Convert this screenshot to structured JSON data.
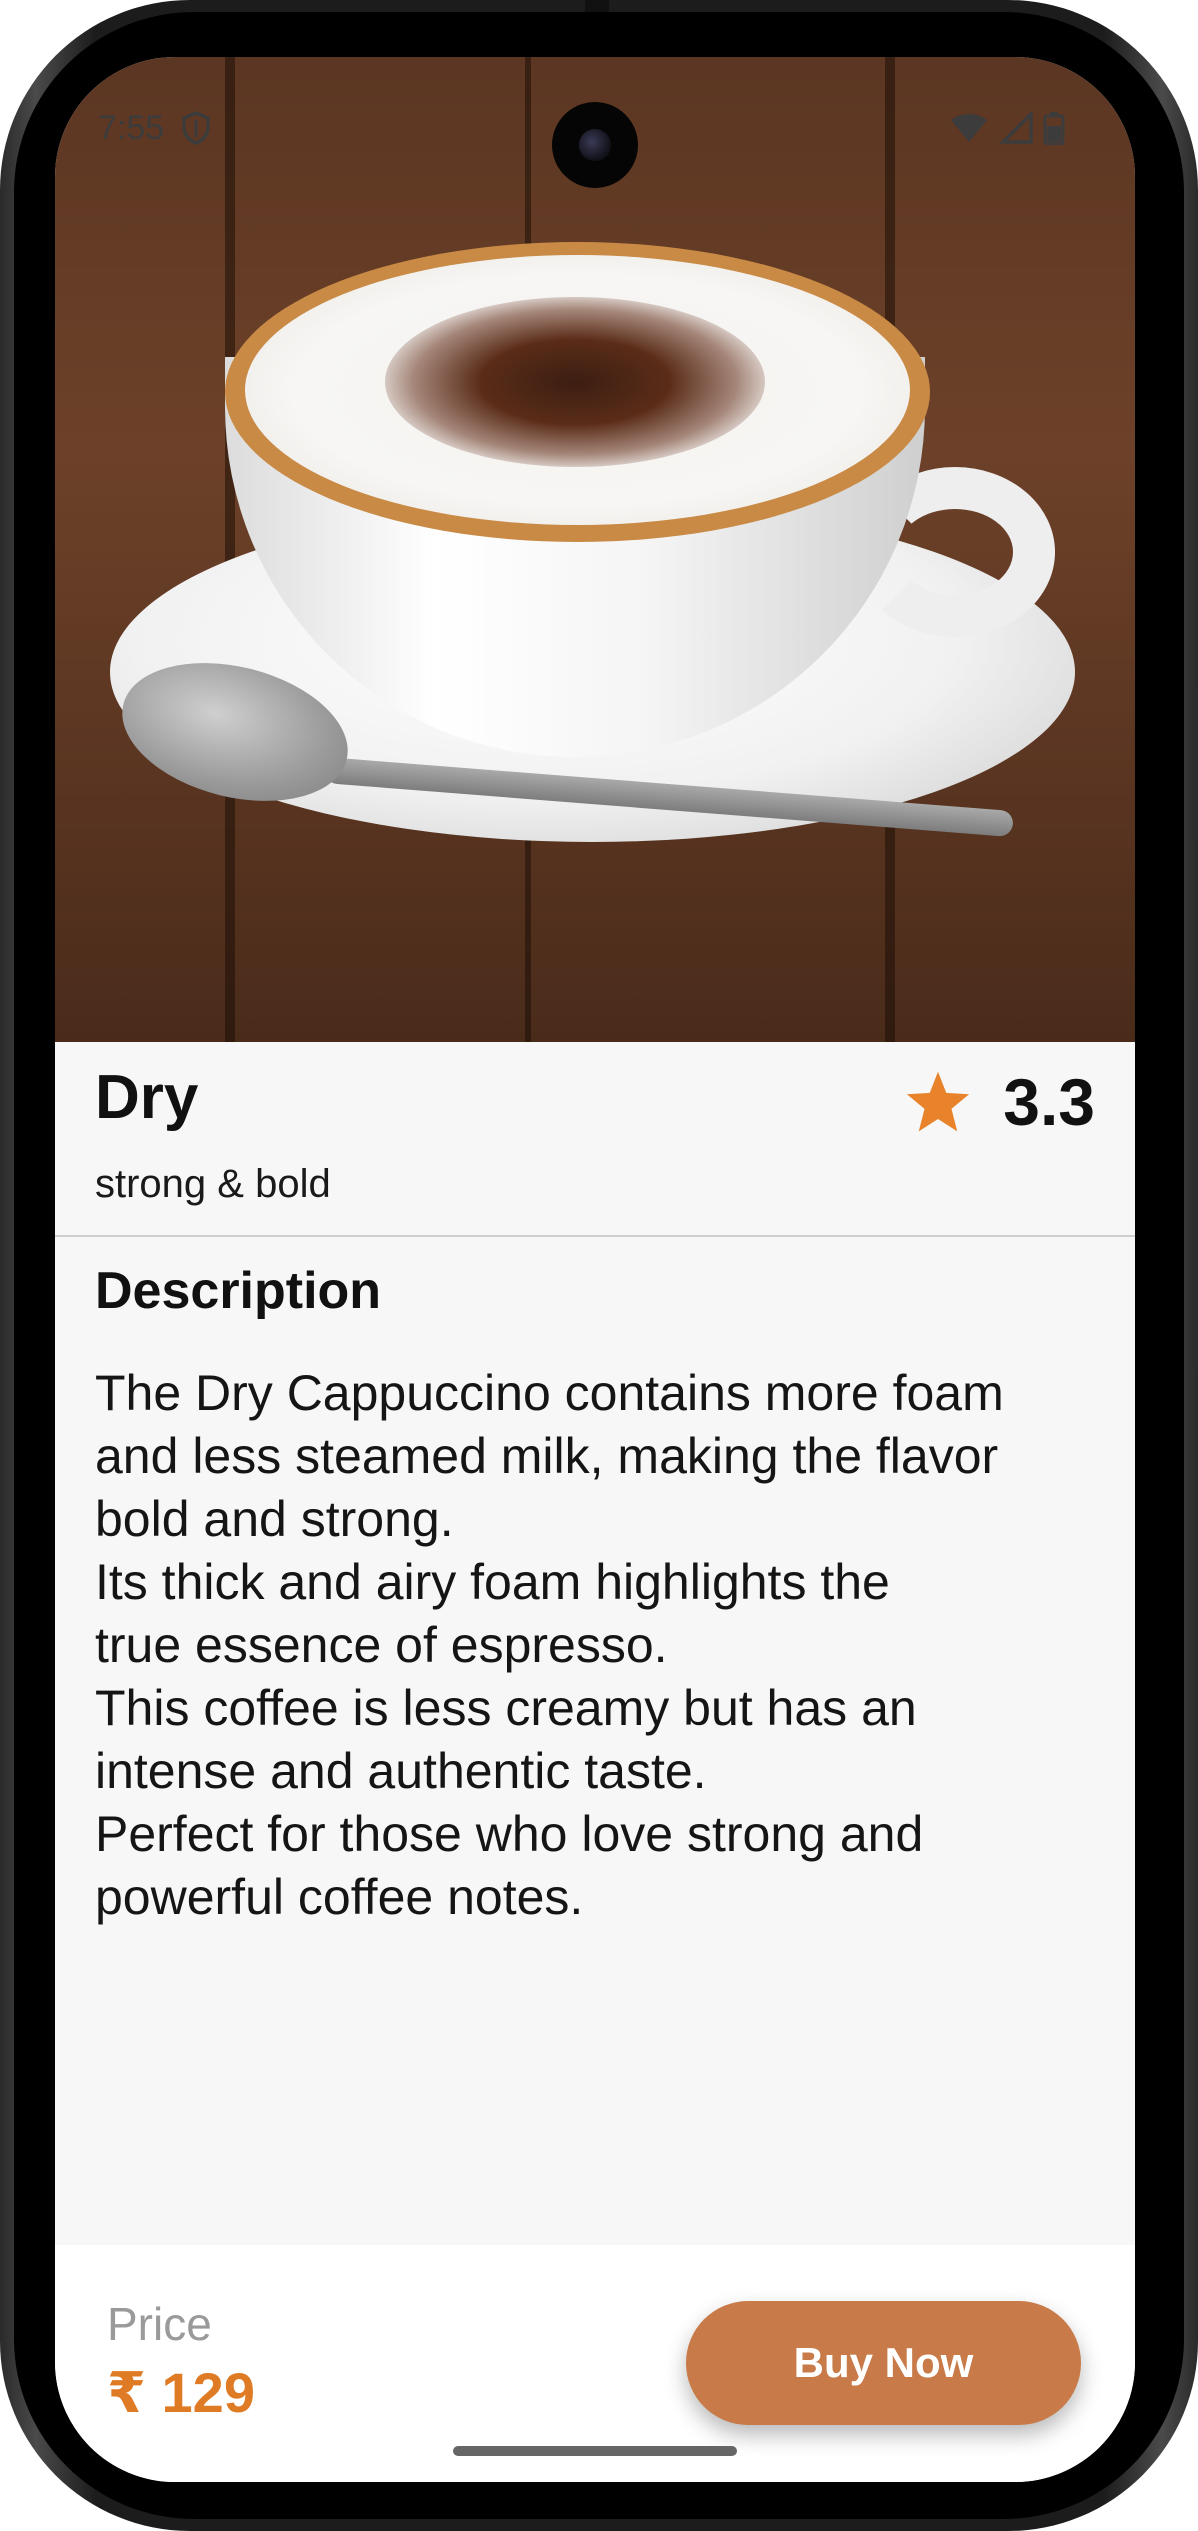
{
  "status_bar": {
    "time": "7:55",
    "icons": [
      "shield-icon",
      "wifi-icon",
      "signal-icon",
      "battery-icon"
    ]
  },
  "product": {
    "image": "cappuccino-cup-photo",
    "name": "Dry",
    "tagline": "strong & bold",
    "rating": "3.3",
    "rating_icon": "star-icon",
    "rating_color": "#E8832B"
  },
  "description": {
    "heading": "Description",
    "lines": [
      "The Dry Cappuccino contains more foam",
      "and less steamed milk, making the flavor",
      "bold and strong.",
      "Its thick and airy foam highlights the",
      "true essence of espresso.",
      "This coffee is less creamy but has an",
      "intense and authentic taste.",
      "Perfect for those who love strong and",
      "powerful coffee notes."
    ]
  },
  "purchase": {
    "price_label": "Price",
    "price": "₹ 129",
    "price_color": "#E07B25",
    "buy_label": "Buy Now",
    "buy_color": "#C87A48"
  }
}
